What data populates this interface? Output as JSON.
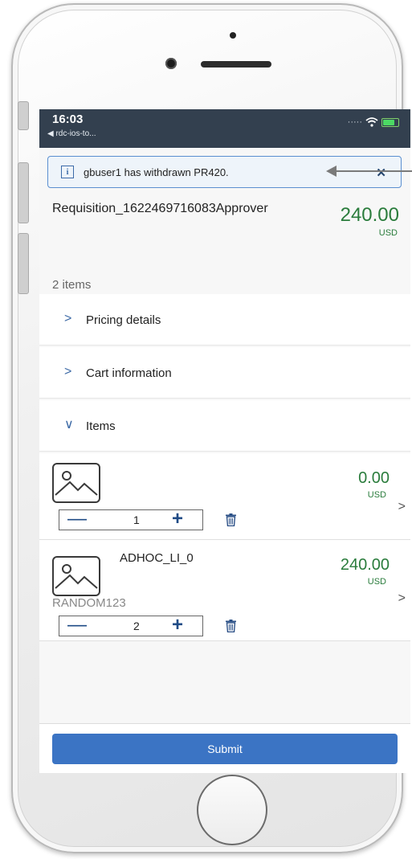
{
  "status_bar": {
    "time": "16:03",
    "back_app": "◀ rdc-ios-to...",
    "signal": "·····"
  },
  "toast": {
    "message": "gbuser1 has withdrawn PR420.",
    "close": "✕"
  },
  "requisition": {
    "title": "Requisition_1622469716083Approver",
    "amount": "240.00",
    "currency": "USD",
    "items_count": "2 items"
  },
  "sections": [
    {
      "chevron": ">",
      "label": "Pricing details"
    },
    {
      "chevron": ">",
      "label": "Cart information"
    },
    {
      "chevron": "∨",
      "label": "Items"
    }
  ],
  "items": [
    {
      "name": "",
      "sub": "",
      "amount": "0.00",
      "currency": "USD",
      "quantity": "1"
    },
    {
      "name": "ADHOC_LI_0",
      "sub": "RANDOM123",
      "amount": "240.00",
      "currency": "USD",
      "quantity": "2"
    }
  ],
  "controls": {
    "minus": "—",
    "plus": "+",
    "next": ">"
  },
  "footer": {
    "submit_label": "Submit"
  },
  "colors": {
    "header": "#33404f",
    "accent": "#3b74c4",
    "amount": "#2a7c3c",
    "toast_border": "#5b8fd0"
  },
  "icons": [
    "info-icon",
    "close-icon",
    "image-placeholder-icon",
    "trash-icon",
    "chevron-right-icon",
    "chevron-down-icon",
    "wifi-icon",
    "battery-icon"
  ]
}
